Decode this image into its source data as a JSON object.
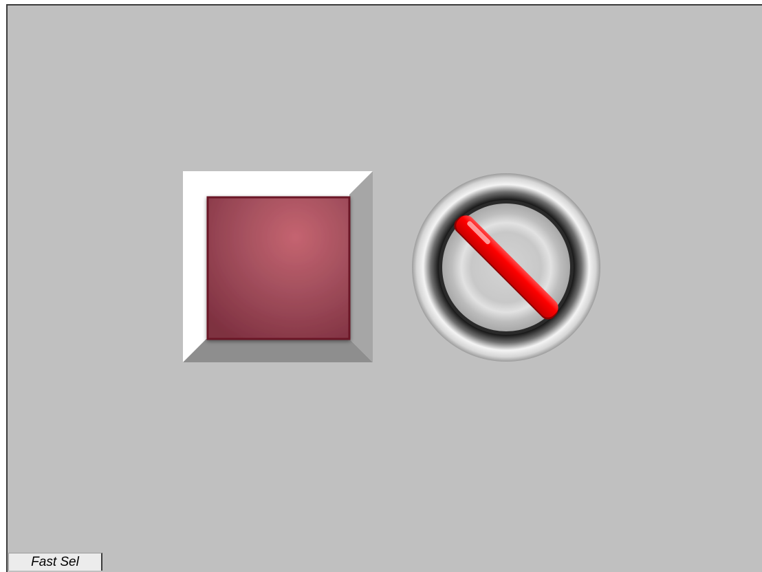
{
  "panel": {
    "background": "#c0c0c0"
  },
  "push_button": {
    "icon": "stop-push-button-icon",
    "face_color": "#9e4a58",
    "bezel_color": "#ffffff"
  },
  "selector_switch": {
    "icon": "selector-switch-icon",
    "handle_color": "#ff0000",
    "position_degrees": 45
  },
  "fast_sel": {
    "label": "Fast Sel"
  }
}
